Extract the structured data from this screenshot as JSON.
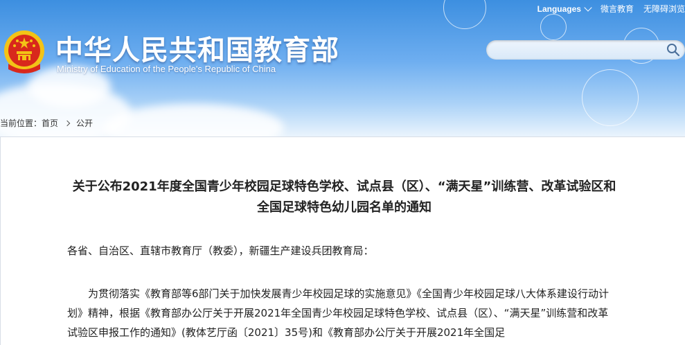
{
  "topbar": {
    "languages": "Languages",
    "weibo": "微言教育",
    "accessible": "无障碍浏览"
  },
  "header": {
    "title_cn": "中华人民共和国教育部",
    "title_en": "Ministry of Education of the People's Republic of China"
  },
  "breadcrumb": {
    "prefix": "当前位置：",
    "home": "首页",
    "current": "公开"
  },
  "article": {
    "title": "关于公布2021年度全国青少年校园足球特色学校、试点县（区）、“满天星”训练营、改革试验区和全国足球特色幼儿园名单的通知",
    "salutation": "各省、自治区、直辖市教育厅（教委），新疆生产建设兵团教育局：",
    "paragraph": "为贯彻落实《教育部等6部门关于加快发展青少年校园足球的实施意见》《全国青少年校园足球八大体系建设行动计划》精神，根据《教育部办公厅关于开展2021年全国青少年校园足球特色学校、试点县（区）、“满天星”训练营和改革试验区申报工作的通知》(教体艺厅函〔2021〕35号)和《教育部办公厅关于开展2021年全国足"
  },
  "colors": {
    "sky_top": "#3d8fe0",
    "sky_bottom": "#eaf4fd",
    "emblem_red": "#d8281c",
    "emblem_gold": "#f3c316"
  },
  "icons": {
    "emblem": "national-emblem-icon",
    "search": "search-icon",
    "chevron": "chevron-down-icon"
  }
}
